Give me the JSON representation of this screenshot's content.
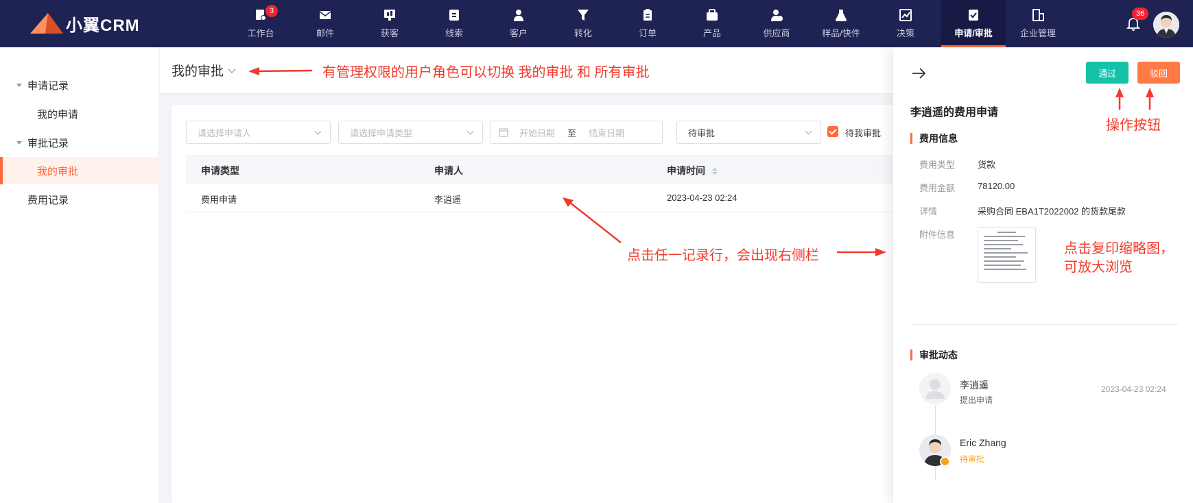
{
  "brand": {
    "name": "小翼CRM"
  },
  "nav": {
    "items": [
      {
        "label": "工作台",
        "icon": "workbench-icon",
        "badge": "3"
      },
      {
        "label": "邮件",
        "icon": "mail-icon"
      },
      {
        "label": "获客",
        "icon": "acquire-icon"
      },
      {
        "label": "线索",
        "icon": "leads-icon"
      },
      {
        "label": "客户",
        "icon": "customer-icon"
      },
      {
        "label": "转化",
        "icon": "funnel-icon"
      },
      {
        "label": "订单",
        "icon": "order-icon"
      },
      {
        "label": "产品",
        "icon": "product-icon"
      },
      {
        "label": "供应商",
        "icon": "supplier-icon"
      },
      {
        "label": "样品/快件",
        "icon": "sample-icon"
      },
      {
        "label": "决策",
        "icon": "chart-icon"
      },
      {
        "label": "申请/审批",
        "icon": "approval-icon",
        "active": true
      },
      {
        "label": "企业管理",
        "icon": "building-icon"
      }
    ],
    "notification_count": "36"
  },
  "sidebar": {
    "groups": [
      {
        "label": "申请记录",
        "items": [
          "我的申请"
        ]
      },
      {
        "label": "审批记录",
        "items": [
          "我的审批"
        ]
      }
    ],
    "extra_item": "费用记录",
    "active_item": "我的审批"
  },
  "header": {
    "title": "我的审批"
  },
  "filters": {
    "applicant_placeholder": "请选择申请人",
    "type_placeholder": "请选择申请类型",
    "start_date_placeholder": "开始日期",
    "date_separator": "至",
    "end_date_placeholder": "结束日期",
    "status_value": "待审批",
    "pending_mine_label": "待我审批"
  },
  "table": {
    "columns": [
      "申请类型",
      "申请人",
      "申请时间"
    ],
    "rows": [
      {
        "type": "费用申请",
        "applicant": "李逍遥",
        "time": "2023-04-23 02:24"
      }
    ]
  },
  "drawer": {
    "pass_label": "通过",
    "reject_label": "驳回",
    "title": "李逍遥的费用申请",
    "expense_section": "费用信息",
    "fields": [
      {
        "key": "费用类型",
        "value": "货款"
      },
      {
        "key": "费用金额",
        "value": "78120.00"
      },
      {
        "key": "详情",
        "value": "采购合同 EBA1T2022002 的货款尾款"
      },
      {
        "key": "附件信息",
        "value": ""
      }
    ],
    "timeline_section": "审批动态",
    "timeline": [
      {
        "name": "李逍遥",
        "action": "提出申请",
        "time": "2023-04-23 02:24"
      },
      {
        "name": "Eric Zhang",
        "action": "待审批",
        "time": ""
      }
    ]
  },
  "annotations": {
    "switch_note": "有管理权限的用户角色可以切换 我的审批 和 所有审批",
    "row_note": "点击任一记录行，会出现右侧栏",
    "action_note": "操作按钮",
    "thumb_note_1": "点击复印缩略图，",
    "thumb_note_2": "可放大浏览"
  },
  "colors": {
    "nav_bg": "#1f2353",
    "accent": "#ff6a3d",
    "pass": "#13c2a9",
    "reject": "#ff7a45",
    "annotation": "#f23a2a"
  }
}
